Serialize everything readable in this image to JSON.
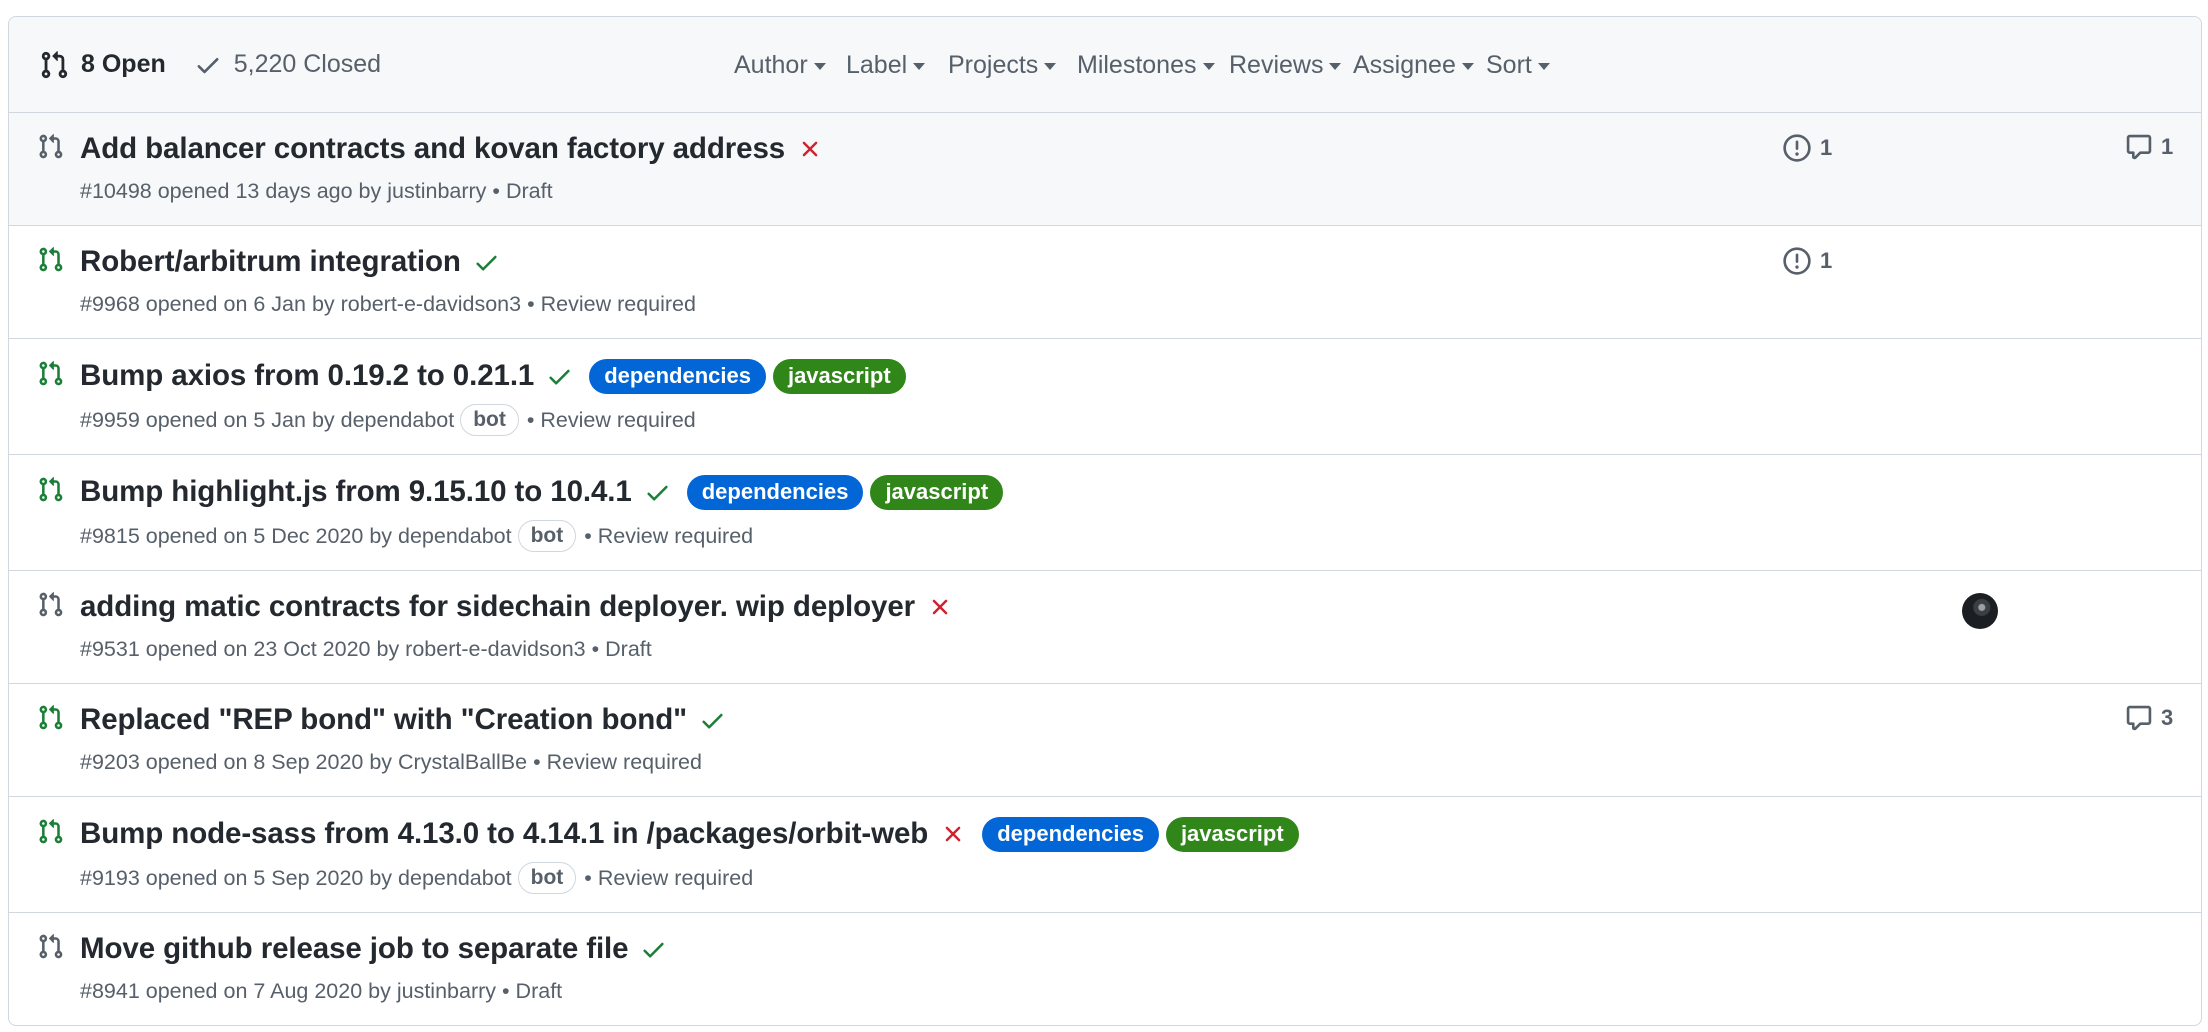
{
  "header": {
    "open_label": "8 Open",
    "closed_label": "5,220 Closed",
    "filters": [
      "Author",
      "Label",
      "Projects",
      "Milestones",
      "Reviews",
      "Assignee",
      "Sort"
    ]
  },
  "colors": {
    "success": "#1a7f37",
    "danger": "#cf222e",
    "label_dependencies": "#0366d6",
    "label_javascript": "#31861a",
    "muted": "#57606a",
    "border": "#d0d7de"
  },
  "pull_requests": [
    {
      "title": "Add balancer contracts and kovan factory address",
      "status": "failure",
      "number": "#10498",
      "opened": "opened 13 days ago by",
      "author": "justinbarry",
      "bot": "",
      "state": "Draft",
      "draft": true,
      "labels": [],
      "linked_issues": "1",
      "comments": "1",
      "has_assignee": false
    },
    {
      "title": "Robert/arbitrum integration",
      "status": "success",
      "number": "#9968",
      "opened": "opened on 6 Jan by",
      "author": "robert-e-davidson3",
      "bot": "",
      "state": "Review required",
      "draft": false,
      "labels": [],
      "linked_issues": "1",
      "comments": "",
      "has_assignee": false
    },
    {
      "title": "Bump axios from 0.19.2 to 0.21.1",
      "status": "success",
      "number": "#9959",
      "opened": "opened on 5 Jan by",
      "author": "dependabot",
      "bot": "bot",
      "state": "Review required",
      "draft": false,
      "labels": [
        "dependencies",
        "javascript"
      ],
      "linked_issues": "",
      "comments": "",
      "has_assignee": false
    },
    {
      "title": "Bump highlight.js from 9.15.10 to 10.4.1",
      "status": "success",
      "number": "#9815",
      "opened": "opened on 5 Dec 2020 by",
      "author": "dependabot",
      "bot": "bot",
      "state": "Review required",
      "draft": false,
      "labels": [
        "dependencies",
        "javascript"
      ],
      "linked_issues": "",
      "comments": "",
      "has_assignee": false
    },
    {
      "title": "adding matic contracts for sidechain deployer. wip deployer",
      "status": "failure",
      "number": "#9531",
      "opened": "opened on 23 Oct 2020 by",
      "author": "robert-e-davidson3",
      "bot": "",
      "state": "Draft",
      "draft": true,
      "labels": [],
      "linked_issues": "",
      "comments": "",
      "has_assignee": true
    },
    {
      "title": "Replaced \"REP bond\" with \"Creation bond\"",
      "status": "success",
      "number": "#9203",
      "opened": "opened on 8 Sep 2020 by",
      "author": "CrystalBallBe",
      "bot": "",
      "state": "Review required",
      "draft": false,
      "labels": [],
      "linked_issues": "",
      "comments": "3",
      "has_assignee": false
    },
    {
      "title": "Bump node-sass from 4.13.0 to 4.14.1 in /packages/orbit-web",
      "status": "failure",
      "number": "#9193",
      "opened": "opened on 5 Sep 2020 by",
      "author": "dependabot",
      "bot": "bot",
      "state": "Review required",
      "draft": false,
      "labels": [
        "dependencies",
        "javascript"
      ],
      "linked_issues": "",
      "comments": "",
      "has_assignee": false
    },
    {
      "title": "Move github release job to separate file",
      "status": "success",
      "number": "#8941",
      "opened": "opened on 7 Aug 2020 by",
      "author": "justinbarry",
      "bot": "",
      "state": "Draft",
      "draft": true,
      "labels": [],
      "linked_issues": "",
      "comments": "",
      "has_assignee": false
    }
  ]
}
